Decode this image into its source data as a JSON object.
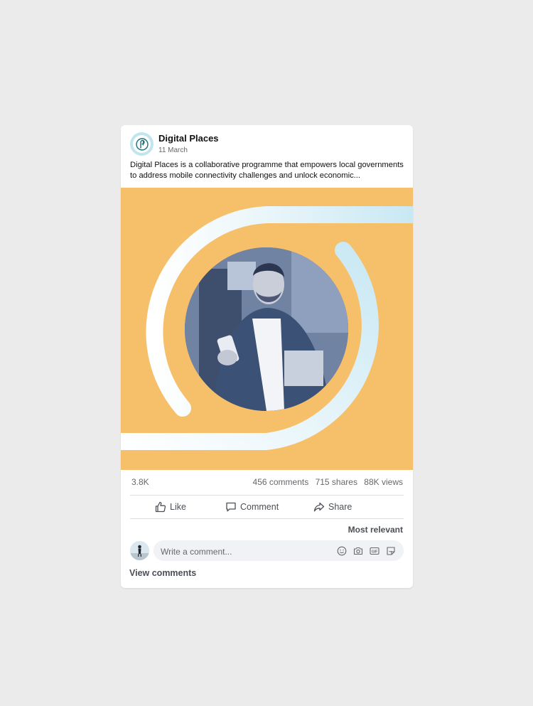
{
  "post": {
    "author": "Digital Places",
    "date": "11 March",
    "text": "Digital Places is a collaborative programme that empowers local governments to address mobile connectivity challenges and unlock economic..."
  },
  "media": {
    "background_color": "#f6c06b",
    "ring_color": "#cfeaf3",
    "photo_subject": "smiling man holding a phone and a parcel"
  },
  "stats": {
    "reactions": "3.8K",
    "comments": "456 comments",
    "shares": "715 shares",
    "views": "88K views"
  },
  "actions": {
    "like": "Like",
    "comment": "Comment",
    "share": "Share"
  },
  "comments": {
    "sort_label": "Most relevant",
    "placeholder": "Write a comment...",
    "view_label": "View comments",
    "tools": [
      "emoji-icon",
      "camera-icon",
      "gif-icon",
      "sticker-icon"
    ]
  }
}
